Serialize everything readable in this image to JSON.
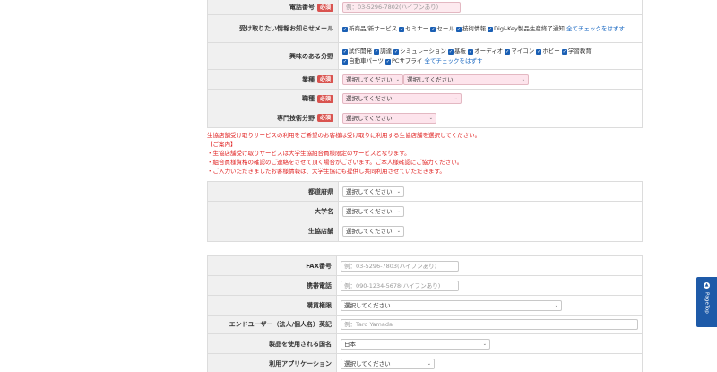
{
  "required_label": "必須",
  "check_mark": "✓",
  "select_default": "選択してください",
  "chevron_glyph": "⌄",
  "top_section": {
    "phone": {
      "label": "電話番号",
      "placeholder": "例：03-5296-7802(ハイフンあり)"
    },
    "newsletter": {
      "label": "受け取りたい情報お知らせメール",
      "options": [
        "新商品/新サービス",
        "セミナー",
        "セール",
        "技術情報",
        "Digi-Key製品生産終了通知"
      ],
      "toggle_link": "全てチェックをはずす"
    },
    "interests": {
      "label": "興味のある分野",
      "options": [
        "試作開発",
        "調達",
        "シミュレーション",
        "基板",
        "オーディオ",
        "マイコン",
        "ホビー",
        "学習教育",
        "自動車パーツ",
        "PCサプライ"
      ],
      "toggle_link": "全てチェックをはずす"
    },
    "industry": {
      "label": "業種",
      "select1": "選択してください",
      "select2": "選択してください"
    },
    "job": {
      "label": "職種",
      "select": "選択してください"
    },
    "tech_field": {
      "label": "専門技術分野",
      "select": "選択してください"
    }
  },
  "notes": [
    "生協店舗受け取りサービスの利用をご希望のお客様は受け取りに利用する生協店舗を選択してください。",
    "【ご案内】",
    "・生協店舗受け取りサービスは大学生協組合員様限定のサービスとなります。",
    "・組合員様資格の確認のご連絡をさせて頂く場合がございます。ご本人様確認にご協力ください。",
    "・ご入力いただきましたお客様情報は、大学生協にも提供し共同利用させていただきます。"
  ],
  "coop_section": {
    "prefecture": {
      "label": "都道府県",
      "select": "選択してください"
    },
    "university": {
      "label": "大学名",
      "select": "選択してください"
    },
    "store": {
      "label": "生協店舗",
      "select": "選択してください"
    }
  },
  "bottom_section": {
    "fax": {
      "label": "FAX番号",
      "placeholder": "例：03-5296-7803(ハイフンあり)"
    },
    "mobile": {
      "label": "携帯電話",
      "placeholder": "例：090-1234-5678(ハイフンあり)"
    },
    "purchase_authority": {
      "label": "購買権限",
      "select": "選択してください"
    },
    "end_user": {
      "label": "エンドユーザー（法人/個人名）英記",
      "placeholder": "例：Taro Yamada"
    },
    "country": {
      "label": "製品を使用される国名",
      "select": "日本"
    },
    "application": {
      "label": "利用アプリケーション",
      "select": "選択してください"
    }
  },
  "side_tab": {
    "label": "PageTop"
  }
}
